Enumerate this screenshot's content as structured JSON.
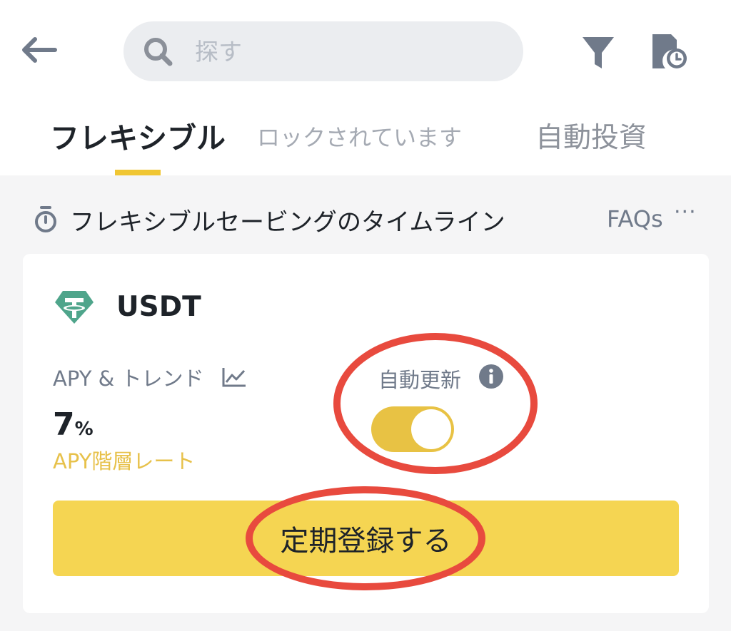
{
  "header": {
    "back_icon": "arrow-left-icon",
    "search": {
      "placeholder": "探す",
      "icon": "search-icon"
    },
    "filter_icon": "filter-icon",
    "history_icon": "document-clock-icon"
  },
  "tabs": [
    {
      "label": "フレキシブル",
      "active": true
    },
    {
      "label": "ロックされています",
      "active": false
    },
    {
      "label": "自動投資",
      "active": false
    }
  ],
  "timeline": {
    "icon": "stopwatch-icon",
    "label": "フレキシブルセービングのタイムライン",
    "faqs_label": "FAQs",
    "more_label": "···"
  },
  "product": {
    "coin_icon": "tether-icon",
    "coin": "USDT",
    "apy_label": "APY & トレンド",
    "trend_icon": "trend-chart-icon",
    "apy_value": "7",
    "apy_unit": "%",
    "apy_tier_label": "APY階層レート",
    "auto_renew_label": "自動更新",
    "info_icon": "info-icon",
    "auto_renew_on": true,
    "subscribe_label": "定期登録する"
  },
  "colors": {
    "accent_yellow": "#f0c633",
    "button_yellow": "#f5d552",
    "toggle_on": "#e8c244",
    "tier_text": "#e7c14a",
    "annotation_red": "#e84a3e",
    "tether_green": "#4fa58b"
  }
}
